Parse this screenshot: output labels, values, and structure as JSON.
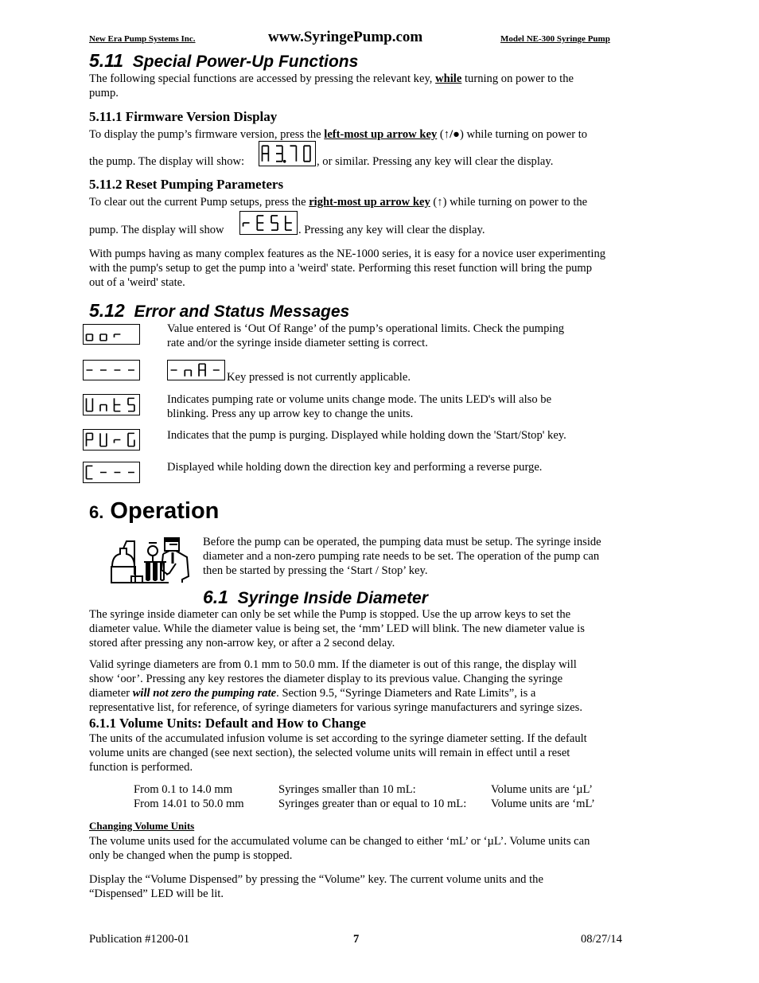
{
  "header": {
    "left": "New Era Pump Systems Inc.",
    "center": "www.SyringePump.com",
    "right": "Model NE-300 Syringe Pump"
  },
  "s511": {
    "number": "5.11",
    "title": "Special Power-Up Functions",
    "intro_a": "The following special functions are accessed by pressing the relevant key, ",
    "intro_b": "while",
    "intro_c": " turning on power to the",
    "intro_d": "pump."
  },
  "s5111": {
    "heading": "5.11.1  Firmware Version Display",
    "l1a": "To display the pump’s firmware version, press the ",
    "l1b": "left-most up arrow key",
    "l1c": " (",
    "l1icon": "↑/●",
    "l1d": ") while turning on power to",
    "l2a": "the pump. The display will show: ",
    "display": "A3.70",
    "l2b": ", or similar.  Pressing any key will clear the display."
  },
  "s5112": {
    "heading": "5.11.2  Reset Pumping Parameters",
    "l1a": "To clear out the current Pump setups, press the ",
    "l1b": "right-most up arrow key",
    "l1c": " (",
    "l1icon": "↑",
    "l1d": ") while turning on power to the",
    "l2a": "pump.  The display will show ",
    "display": "rESt",
    "l2b": ".  Pressing any key will clear the display.",
    "p2": [
      "With pumps having as many complex features as the NE-1000 series, it is easy for a novice user experimenting",
      "with the pump's setup to get the pump into a 'weird' state.  Performing this reset function will bring the pump",
      "out of a 'weird' state."
    ]
  },
  "s512": {
    "number": "5.12",
    "title": "Error and Status Messages",
    "messages": [
      {
        "display": "oor",
        "lines": [
          "Value entered is ‘Out Of Range’ of the pump’s operational limits.  Check the pumping",
          "rate and/or the syringe inside diameter setting is correct."
        ]
      },
      {
        "display": "----",
        "display2": "-nA-",
        "lines": [
          "Key pressed is not currently applicable."
        ]
      },
      {
        "display": "UntS",
        "lines": [
          "Indicates pumping rate or volume units change mode.  The units LED's will also be",
          "blinking.  Press any up arrow key to change the units."
        ]
      },
      {
        "display": "PUrG",
        "lines": [
          "Indicates that the pump is purging.  Displayed while holding down the 'Start/Stop' key."
        ]
      },
      {
        "display": "[---",
        "lines": [
          "Displayed while holding down the direction key and performing a reverse purge."
        ]
      }
    ]
  },
  "s6": {
    "number": "6.",
    "title": "Operation",
    "intro": [
      "Before the pump can be operated, the pumping data must be setup.  The syringe inside",
      "diameter and a non-zero pumping rate needs to be set.  The operation of the pump can",
      "then be started by pressing the ‘Start / Stop’ key."
    ],
    "illustration": "scientist-with-lab-equipment"
  },
  "s61": {
    "number": "6.1",
    "title": "Syringe Inside Diameter",
    "p1": [
      "The syringe inside diameter can only be set while the Pump is stopped.  Use the up arrow keys to set the",
      "diameter value.  While the diameter value is being set, the ‘mm’ LED will blink.  The new diameter value is",
      "stored after pressing any non-arrow key, or after a 2 second delay."
    ],
    "p2_l1": "Valid syringe diameters are from 0.1 mm to 50.0 mm.  If the diameter is out of this range, the display will",
    "p2_l2": "show ‘oor’.  Pressing any key restores the diameter display to its previous value.  Changing the syringe",
    "p2_l3a": "diameter ",
    "p2_l3b": "will not zero the pumping rate",
    "p2_l3c": ".  Section 9.5, “Syringe Diameters and Rate Limits”, is a",
    "p2_l4": "representative list, for reference, of syringe diameters for various syringe manufacturers and syringe sizes."
  },
  "s611": {
    "heading": "6.1.1  Volume Units:  Default and How to Change",
    "p1": [
      "The units of the accumulated infusion volume is set according to the syringe diameter setting.  If the default",
      "volume units are changed (see next section), the selected volume units will remain in effect until a reset",
      "function is performed."
    ],
    "table": [
      {
        "range": "From 0.1 to 14.0 mm",
        "syringe": "Syringes smaller than 10 mL:",
        "units": "Volume units are ‘µL’"
      },
      {
        "range": "From 14.01 to 50.0 mm",
        "syringe": "Syringes greater than or equal to 10 mL:",
        "units": "Volume units are ‘mL’"
      }
    ],
    "sub_heading": "Changing Volume Units",
    "p2": [
      "The volume units used for the accumulated volume can be changed to either ‘mL’ or ‘µL’.  Volume units can",
      "only be changed when the pump is stopped."
    ],
    "p3": [
      "Display the “Volume Dispensed” by pressing the “Volume” key.  The current volume units and the",
      "“Dispensed” LED will be lit."
    ]
  },
  "footer": {
    "publication": "Publication  #1200-01",
    "page": "7",
    "date": "08/27/14"
  }
}
